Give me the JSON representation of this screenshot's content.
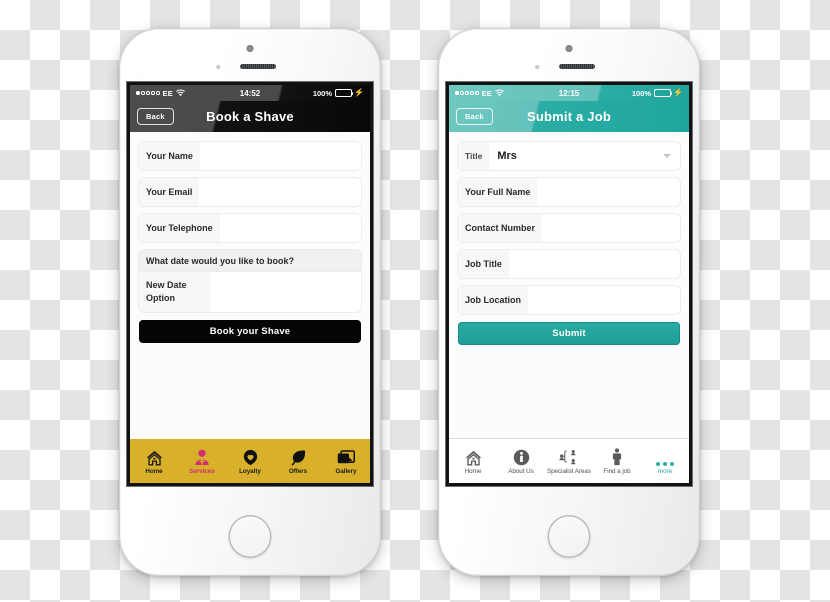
{
  "scene": {
    "description": "Two white iPhones side by side on a transparent checkerboard background showing mobile app form screens",
    "background_checker_light": "#ffffff",
    "background_checker_dark": "#e4e4e4"
  },
  "phones": [
    {
      "id": "phone-left",
      "theme": "dark",
      "accent": "#111111",
      "status_bar": {
        "signal_dots_total": 5,
        "signal_dots_filled": 1,
        "carrier": "EE",
        "wifi_icon": "wifi-icon",
        "time": "14:52",
        "battery_percent": "100%",
        "battery_fill_color": "#4cd964",
        "charging_icon": "bolt-icon"
      },
      "titlebar": {
        "back_label": "Back",
        "title": "Book a Shave"
      },
      "form": {
        "fields": [
          {
            "label": "Your Name",
            "value": ""
          },
          {
            "label": "Your Email",
            "value": ""
          },
          {
            "label": "Your Telephone",
            "value": ""
          }
        ],
        "date_group": {
          "heading": "What date would you like to book?",
          "line1": "New Date",
          "line2": "Option"
        },
        "cta_label": "Book your Shave",
        "cta_color": "#050505"
      },
      "tabbar": {
        "background": "#d8b02a",
        "active_color": "#cf2f72",
        "items": [
          {
            "icon": "home-icon",
            "label": "Home",
            "active": false
          },
          {
            "icon": "person-services-icon",
            "label": "Services",
            "active": true
          },
          {
            "icon": "heart-loyalty-icon",
            "label": "Loyalty",
            "active": false
          },
          {
            "icon": "leaf-offers-icon",
            "label": "Offers",
            "active": false
          },
          {
            "icon": "photos-gallery-icon",
            "label": "Gallery",
            "active": false
          }
        ]
      }
    },
    {
      "id": "phone-right",
      "theme": "teal",
      "accent": "#2aada5",
      "status_bar": {
        "signal_dots_total": 5,
        "signal_dots_filled": 1,
        "carrier": "EE",
        "wifi_icon": "wifi-icon",
        "time": "12:15",
        "battery_percent": "100%",
        "battery_fill_color": "#4cd964",
        "charging_icon": "bolt-icon"
      },
      "titlebar": {
        "back_label": "Back",
        "title": "Submit a Job"
      },
      "form": {
        "title_select": {
          "label": "Title",
          "value": "Mrs",
          "chevron_icon": "chevron-down-icon"
        },
        "fields": [
          {
            "label": "Your Full Name",
            "value": ""
          },
          {
            "label": "Contact Number",
            "value": ""
          },
          {
            "label": "Job Title",
            "value": ""
          },
          {
            "label": "Job Location",
            "value": ""
          }
        ],
        "cta_label": "Submit",
        "cta_color": "#28aba3"
      },
      "tabbar": {
        "background": "#ffffff",
        "accent_color": "#2aada5",
        "items": [
          {
            "icon": "home-icon",
            "label": "Home",
            "more": false
          },
          {
            "icon": "info-about-icon",
            "label": "About Us",
            "more": false
          },
          {
            "icon": "people-specialist-icon",
            "label": "Specialist Areas",
            "more": false
          },
          {
            "icon": "person-find-job-icon",
            "label": "Find a job",
            "more": false
          },
          {
            "icon": "ellipsis-more-icon",
            "label": "more",
            "more": true
          }
        ]
      }
    }
  ]
}
